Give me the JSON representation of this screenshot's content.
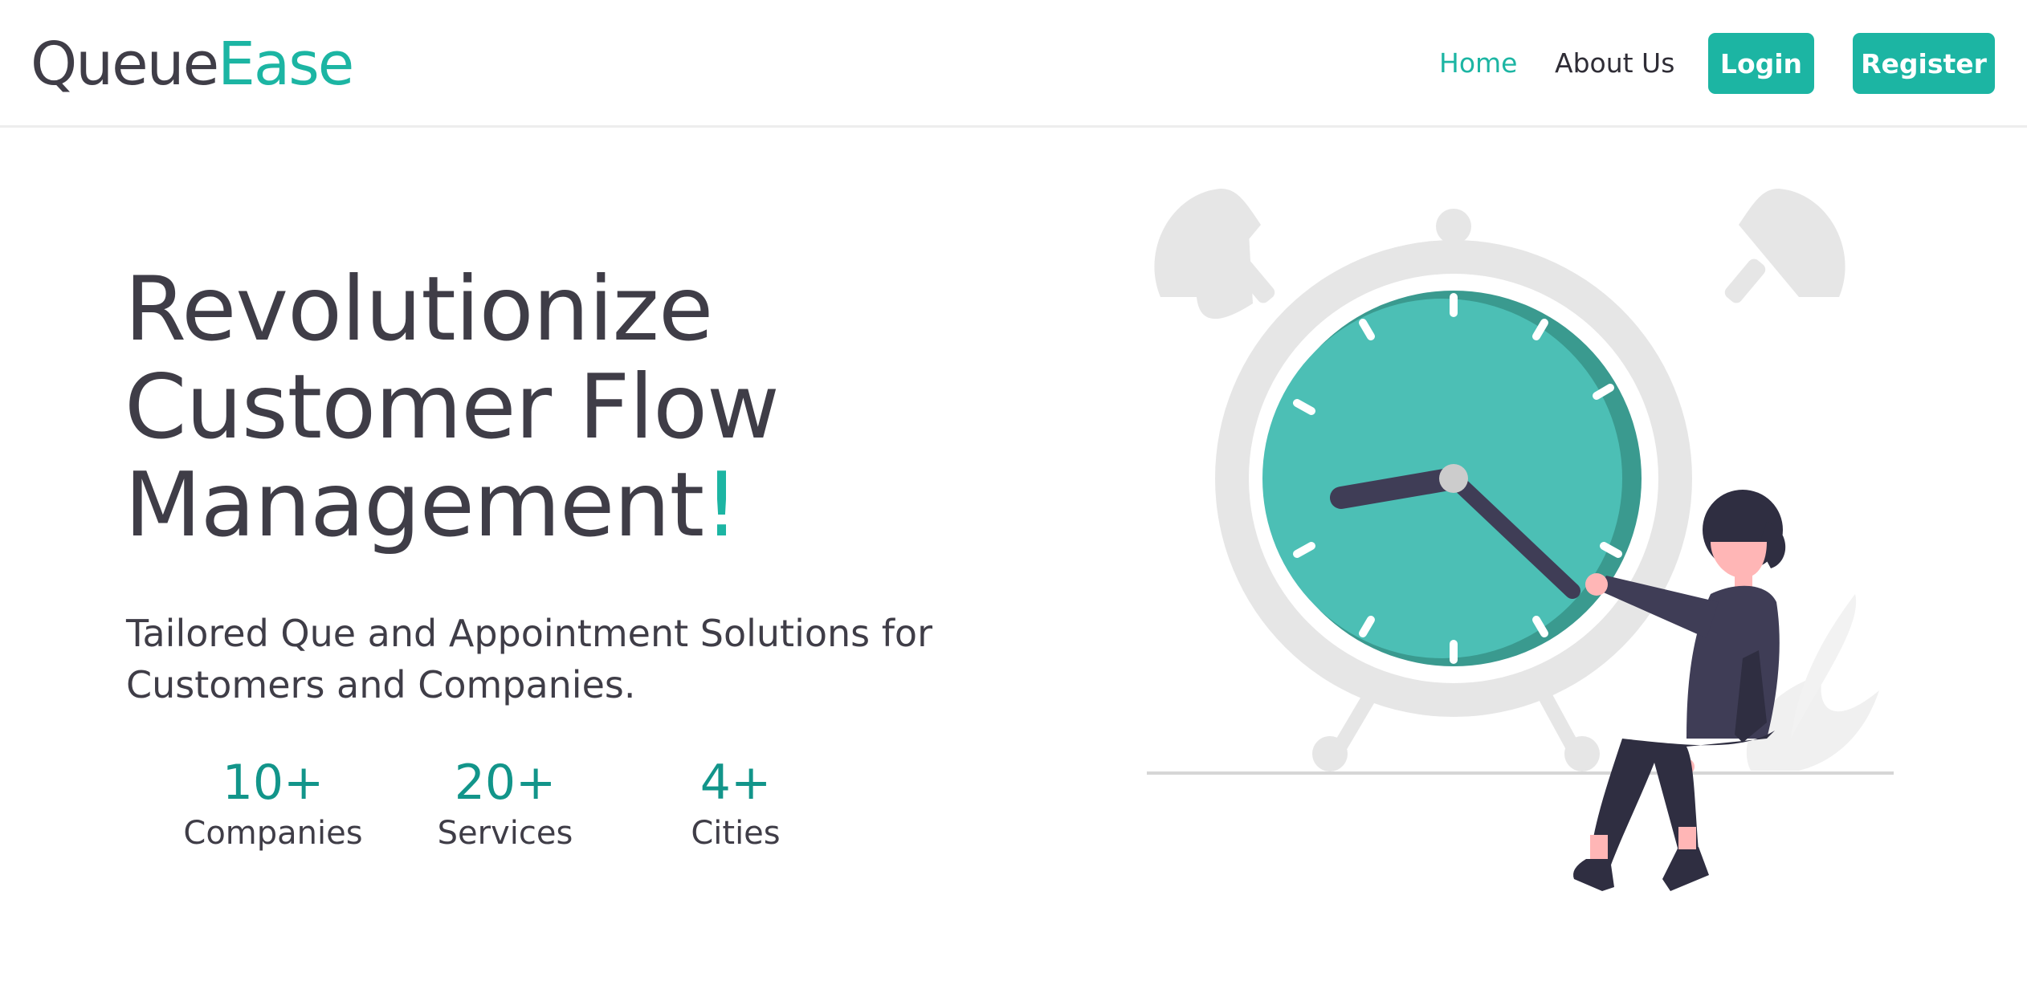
{
  "header": {
    "logo": {
      "part1": "Queue",
      "part2": "Ease"
    },
    "nav": {
      "home": "Home",
      "about": "About Us"
    },
    "buttons": {
      "login": "Login",
      "register": "Register"
    }
  },
  "hero": {
    "title_lines": [
      "Revolutionize",
      "Customer Flow",
      "Management"
    ],
    "title_accent": "!",
    "subtitle_lines": [
      "Tailored Que and Appointment Solutions for",
      "Customers and Companies."
    ],
    "stats": [
      {
        "value": "10+",
        "label": "Companies"
      },
      {
        "value": "20+",
        "label": "Services"
      },
      {
        "value": "4+",
        "label": "Cities"
      }
    ]
  },
  "illustration": {
    "icon": "alarm-clock-woman-illustration"
  },
  "colors": {
    "accent": "#1cb5a3",
    "stat": "#12958a",
    "text": "#3f3d47",
    "clock_face": "#4cbfb5",
    "clock_shadow": "#3a9a8f",
    "clock_frame": "#e6e6e6",
    "figure_dark": "#3f3d56",
    "skin": "#ffb6b6"
  }
}
